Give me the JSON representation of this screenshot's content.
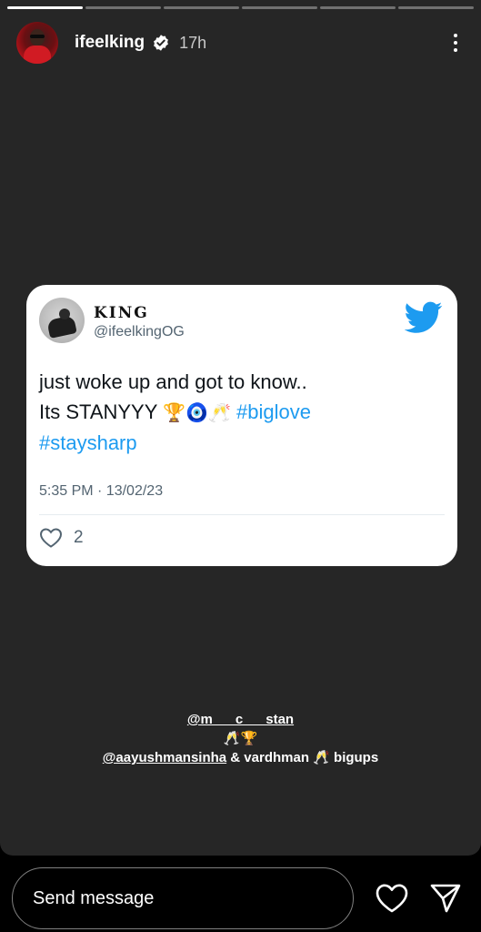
{
  "story": {
    "progress_segments": [
      1,
      0,
      0,
      0,
      0,
      0
    ],
    "user": {
      "username": "ifeelking",
      "time_ago": "17h"
    }
  },
  "tweet": {
    "name": "KING",
    "handle": "@ifeelkingOG",
    "text_line1": "just woke up and got to know..",
    "text_line2_prefix": "Its STANYYY",
    "emoji_trophy": "🏆",
    "emoji_nazar": "🧿",
    "emoji_clink": "🥂",
    "hashtag1": "#biglove",
    "hashtag2": "#staysharp",
    "timestamp": "5:35 PM · 13/02/23",
    "likes": "2"
  },
  "caption": {
    "mention1": "@m___c___stan",
    "emoji_line": "🥂🏆",
    "mention2": "@aayushmansinha",
    "line2_rest": " & vardhman ",
    "emoji_clink": "🥂",
    "line2_end": " bigups"
  },
  "reply": {
    "placeholder": "Send message"
  },
  "colors": {
    "twitter_blue": "#1d9bf0",
    "story_background": "#262626"
  },
  "icons": [
    "verified-badge-icon",
    "more-options-icon",
    "twitter-bird-icon",
    "heart-outline-icon",
    "send-icon"
  ]
}
